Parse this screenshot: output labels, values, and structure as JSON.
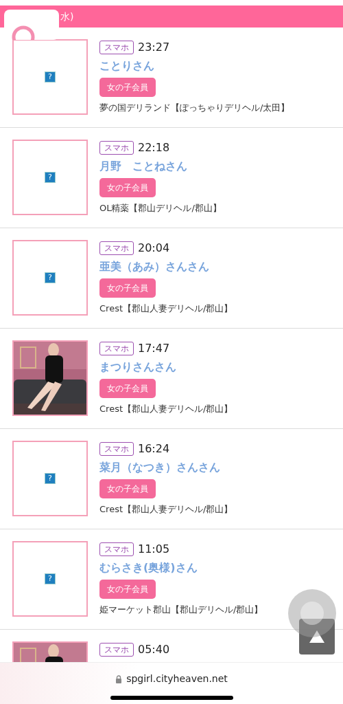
{
  "header": {
    "date_fragment": "水)"
  },
  "entries": [
    {
      "kind": "broken-image",
      "icon_text": "?",
      "device_tag": "スマホ",
      "time": "23:27",
      "name": "ことりさん",
      "member_badge": "女の子会員",
      "shop": "夢の国デリランド【ぽっちゃりデリヘル/太田】"
    },
    {
      "kind": "broken-image",
      "icon_text": "?",
      "device_tag": "スマホ",
      "time": "22:18",
      "name": "月野　ことねさん",
      "member_badge": "女の子会員",
      "shop": "OL精薬【郡山デリヘル/郡山】"
    },
    {
      "kind": "broken-image",
      "icon_text": "?",
      "device_tag": "スマホ",
      "time": "20:04",
      "name": "亜美（あみ）さんさん",
      "member_badge": "女の子会員",
      "shop": "Crest【郡山人妻デリヘル/郡山】"
    },
    {
      "kind": "picture",
      "device_tag": "スマホ",
      "time": "17:47",
      "name": "まつりさんさん",
      "member_badge": "女の子会員",
      "shop": "Crest【郡山人妻デリヘル/郡山】"
    },
    {
      "kind": "broken-image",
      "icon_text": "?",
      "device_tag": "スマホ",
      "time": "16:24",
      "name": "菜月（なつき）さんさん",
      "member_badge": "女の子会員",
      "shop": "Crest【郡山人妻デリヘル/郡山】"
    },
    {
      "kind": "broken-image",
      "icon_text": "?",
      "device_tag": "スマホ",
      "time": "11:05",
      "name": "むらさき(奥様)さん",
      "member_badge": "女の子会員",
      "shop": "姫マーケット郡山【郡山デリヘル/郡山】"
    },
    {
      "kind": "picture",
      "device_tag": "スマホ",
      "time": "05:40"
    }
  ],
  "browser_bar": {
    "url": "spgirl.cityheaven.net"
  }
}
